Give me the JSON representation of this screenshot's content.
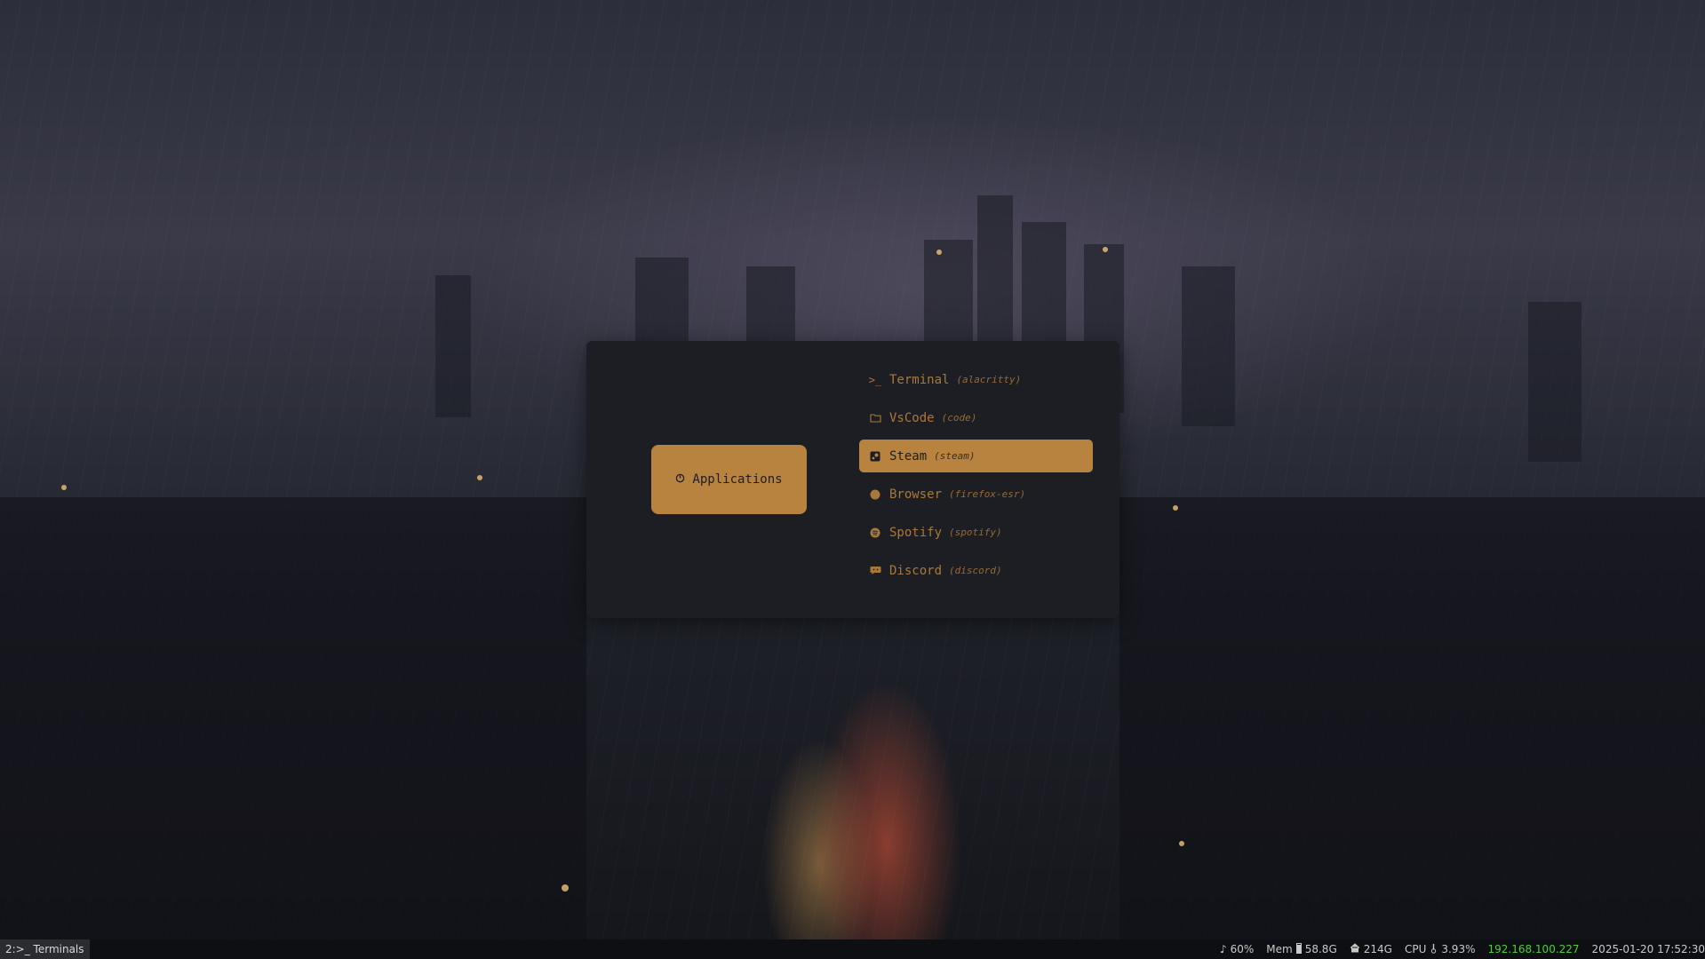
{
  "launcher": {
    "mode_label": "Applications",
    "mode_icon": "app-grid-icon",
    "items": [
      {
        "label": "Terminal",
        "command": "(alacritty)",
        "icon": "terminal-icon",
        "selected": false
      },
      {
        "label": "VsCode",
        "command": "(code)",
        "icon": "folder-icon",
        "selected": false
      },
      {
        "label": "Steam",
        "command": "(steam)",
        "icon": "steam-icon",
        "selected": true
      },
      {
        "label": "Browser",
        "command": "(firefox-esr)",
        "icon": "firefox-icon",
        "selected": false
      },
      {
        "label": "Spotify",
        "command": "(spotify)",
        "icon": "spotify-icon",
        "selected": false
      },
      {
        "label": "Discord",
        "command": "(discord)",
        "icon": "discord-icon",
        "selected": false
      }
    ]
  },
  "statusbar": {
    "workspace": "2:>_ Terminals",
    "volume": "60%",
    "memory_label": "Mem",
    "memory_value": "58.8G",
    "disk_value": "214G",
    "cpu_label": "CPU",
    "cpu_value": "3.93%",
    "ip": "192.168.100.227",
    "datetime": "2025-01-20 17:52:30"
  },
  "colors": {
    "accent": "#b8833e",
    "launcher_bg": "#1d1e23",
    "ip": "#4cd137"
  }
}
